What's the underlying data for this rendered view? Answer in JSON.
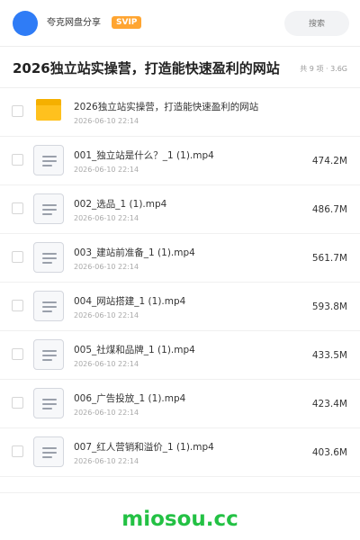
{
  "header": {
    "share_name": "夸克网盘分享",
    "badge": "SVIP",
    "search_placeholder": "搜索"
  },
  "title_bar": {
    "title": "2026独立站实操营，打造能快速盈利的网站",
    "meta": "共 9 项 · 3.6G"
  },
  "colors": {
    "accent": "#2f7cf6",
    "svip": "#ffa531",
    "folder": "#ffc11e",
    "watermark": "#23c144"
  },
  "files": [
    {
      "type": "folder",
      "icon": "folder-icon",
      "name": "2026独立站实操营，打造能快速盈利的网站",
      "date": "2026-06-10 22:14",
      "size": ""
    },
    {
      "type": "file",
      "icon": "video-file-icon",
      "name": "001_独立站是什么？_1 (1).mp4",
      "date": "2026-06-10 22:14",
      "size": "474.2M"
    },
    {
      "type": "file",
      "icon": "video-file-icon",
      "name": "002_选品_1 (1).mp4",
      "date": "2026-06-10 22:14",
      "size": "486.7M"
    },
    {
      "type": "file",
      "icon": "video-file-icon",
      "name": "003_建站前准备_1 (1).mp4",
      "date": "2026-06-10 22:14",
      "size": "561.7M"
    },
    {
      "type": "file",
      "icon": "video-file-icon",
      "name": "004_网站搭建_1 (1).mp4",
      "date": "2026-06-10 22:14",
      "size": "593.8M"
    },
    {
      "type": "file",
      "icon": "video-file-icon",
      "name": "005_社煤和品牌_1 (1).mp4",
      "date": "2026-06-10 22:14",
      "size": "433.5M"
    },
    {
      "type": "file",
      "icon": "video-file-icon",
      "name": "006_广告投放_1 (1).mp4",
      "date": "2026-06-10 22:14",
      "size": "423.4M"
    },
    {
      "type": "file",
      "icon": "video-file-icon",
      "name": "007_红人营销和溢价_1 (1).mp4",
      "date": "2026-06-10 22:14",
      "size": "403.6M"
    }
  ],
  "watermark": "miosou.cc"
}
